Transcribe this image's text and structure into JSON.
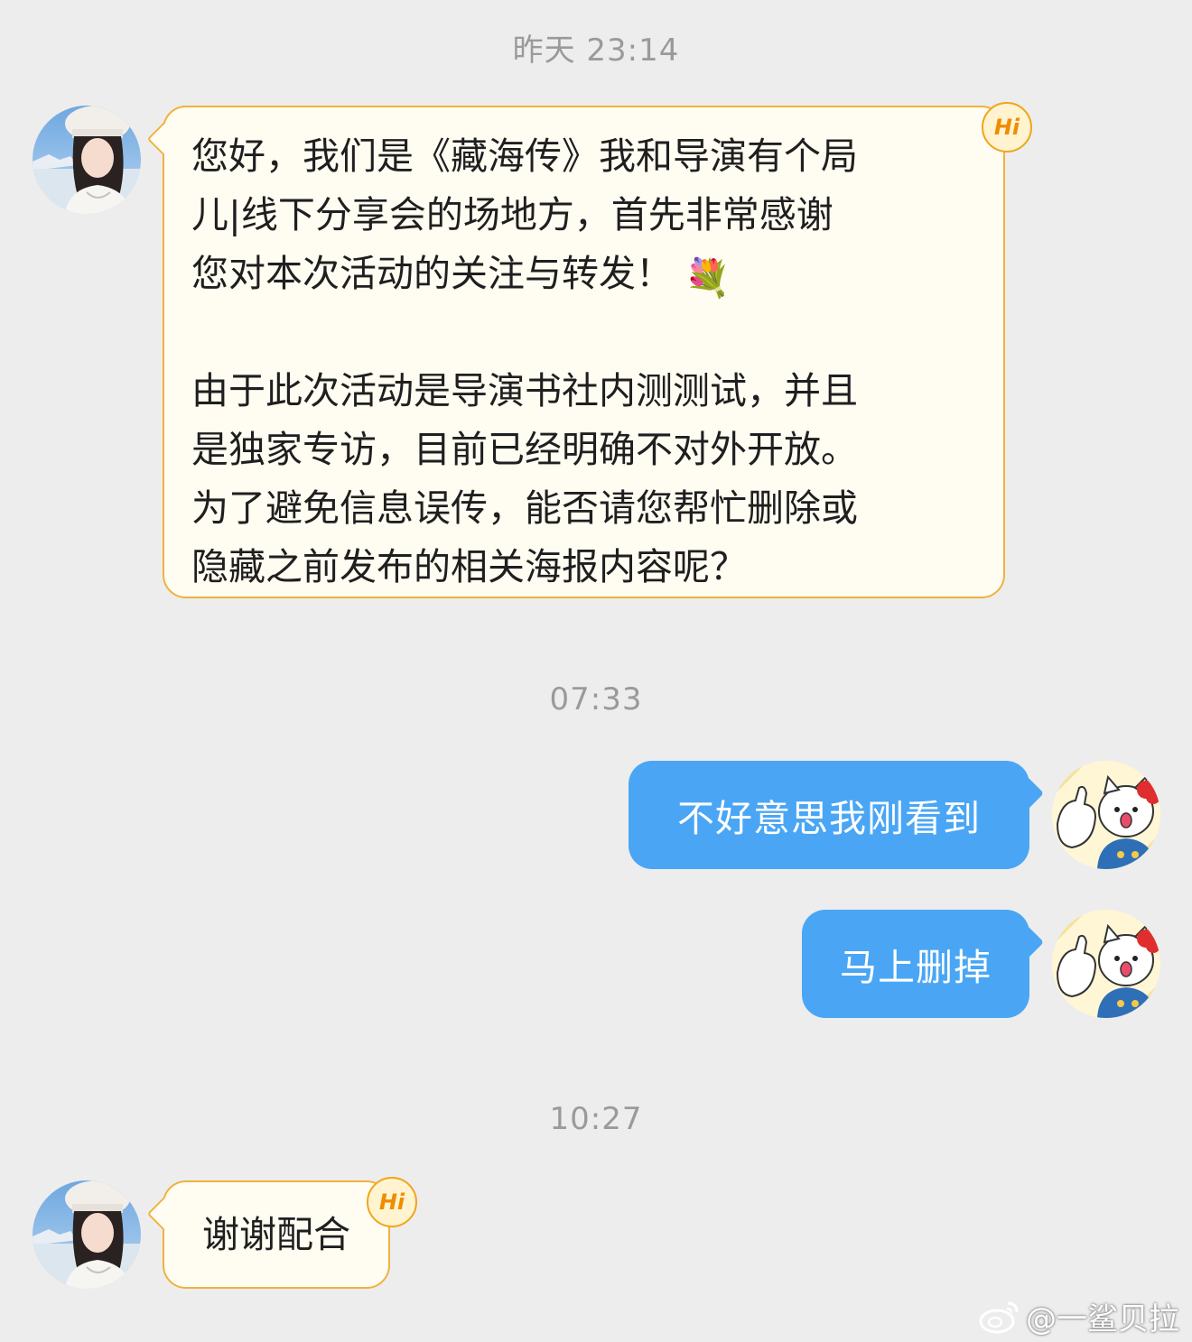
{
  "timestamps": {
    "t1": "昨天 23:14",
    "t2": "07:33",
    "t3": "10:27"
  },
  "messages": {
    "incoming_1": {
      "line1": "您好，我们是《藏海传》我和导演有个局",
      "line2": "儿|线下分享会的场地方，首先非常感谢",
      "line3": "您对本次活动的关注与转发！",
      "emoji": "💐",
      "para2_line1": "由于此次活动是导演书社内测测试，并且",
      "para2_line2": "是独家专访，目前已经明确不对外开放。",
      "para2_line3": "为了避免信息误传，能否请您帮忙删除或",
      "para2_line4": "隐藏之前发布的相关海报内容呢？"
    },
    "outgoing_1": "不好意思我刚看到",
    "outgoing_2": "马上删掉",
    "incoming_2": "谢谢配合"
  },
  "badges": {
    "hi": "Hi"
  },
  "icons": {
    "incoming_avatar": "user-avatar-photo",
    "outgoing_avatar": "cartoon-cat-avatar",
    "badge": "hi-badge-icon",
    "watermark": "weibo-logo-icon"
  },
  "colors": {
    "background": "#EDEDED",
    "incoming_bubble": "#FFFCF2",
    "incoming_border": "#F0B23C",
    "outgoing_bubble": "#4AA6F4",
    "timestamp": "#9A9A9A"
  },
  "watermark": "@一鲨贝拉"
}
